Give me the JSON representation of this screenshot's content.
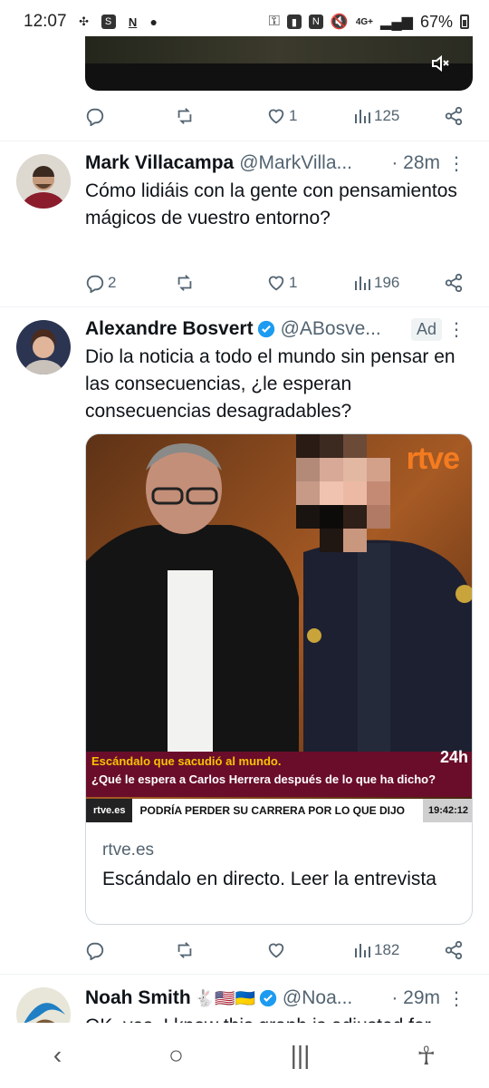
{
  "status": {
    "time": "12:07",
    "left_icons": [
      "slack-icon",
      "s-app-icon",
      "n-app-icon",
      "dot-icon"
    ],
    "right_icons": [
      "key-icon",
      "battery-saver-icon",
      "nfc-icon",
      "mute-icon"
    ],
    "network": "4G+",
    "battery": "67%"
  },
  "video": {
    "mute_icon": "speaker-mute-icon"
  },
  "tweet0": {
    "likes": "1",
    "views": "125"
  },
  "tweet1": {
    "name": "Mark Villacampa",
    "handle": "@MarkVilla...",
    "time": "· 28m",
    "text": "Cómo lidiáis con la gente con pensamientos mágicos de vuestro entorno?",
    "replies": "2",
    "likes": "1",
    "views": "196"
  },
  "tweet2": {
    "name": "Alexandre Bosvert",
    "handle": "@ABosve...",
    "ad": "Ad",
    "text": "Dio la noticia a todo el mundo sin pensar en las consecuencias, ¿le esperan consecuencias desagradables?",
    "card": {
      "logo": "rtve",
      "banner_small": "Escándalo que sacudió al mundo.",
      "banner_main": "¿Qué le espera a Carlos Herrera después de lo que ha dicho?",
      "channel_badge": "24h",
      "ticker_brand": "rtve.es",
      "ticker_text": "PODRÍA PERDER SU CARRERA POR LO QUE DIJO",
      "ticker_time": "19:42:12",
      "domain": "rtve.es",
      "title": "Escándalo en directo. Leer la entrevista"
    },
    "views": "182"
  },
  "tweet3": {
    "name": "Noah Smith",
    "emojis": "🐇🇺🇸🇺🇦",
    "handle": "@Noa...",
    "time": "· 29m",
    "text_partial": "OK, yes, I know this graph is adjusted for"
  },
  "colors": {
    "accent": "#1d9bf0",
    "muted": "#536471"
  }
}
